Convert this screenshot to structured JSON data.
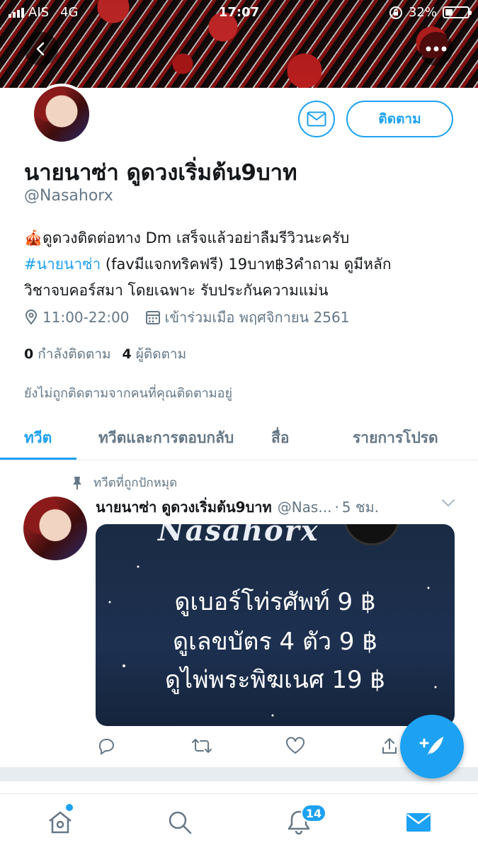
{
  "status_bar": {
    "carrier": "AIS",
    "network": "4G",
    "time": "17:07",
    "battery_percent": "32%",
    "battery_level": 0.32
  },
  "profile": {
    "name": "นายนาซ่า ดูดวงเริ่มต้น9บาท",
    "handle": "@Nasahorx",
    "bio_emoji": "🎪",
    "bio_line1": "ดูดวงติดต่อทาง Dm เสร็จแล้วอย่าลืมรีวิวนะครับ",
    "bio_hashtag": "#นายนาซ่า",
    "bio_line2_rest": " (favมีแจกทริคฟรี) 19บาท฿3คำถาม ดูมีหลัก",
    "bio_line3": "วิชาจบคอร์สมา โดยเฉพาะ รับประกันความแม่น",
    "location": "11:00-22:00",
    "joined": "เข้าร่วมเมือ พฤศจิกายน 2561",
    "following_count": "0",
    "following_label": "กำลังติดตาม",
    "followers_count": "4",
    "followers_label": "ผู้ติดตาม",
    "not_followed_text": "ยังไม่ถูกติดตามจากคนที่คุณติดตามอยู่",
    "follow_button": "ติดตาม"
  },
  "tabs": [
    {
      "label": "ทวีต",
      "active": true
    },
    {
      "label": "ทวีตและการตอบกลับ",
      "active": false
    },
    {
      "label": "สื่อ",
      "active": false
    },
    {
      "label": "รายการโปรด",
      "active": false
    }
  ],
  "tweet": {
    "pinned_label": "ทวีตที่ถูกปักหมุด",
    "author_name": "นายนาซ่า ดูดวงเริ่มต้น9บาท",
    "author_handle": "@Nas...",
    "separator": "·",
    "time": "5 ชม.",
    "media": {
      "brand": "Nasahorx",
      "line1": "ดูเบอร์โท่รศัพท์ 9 ฿",
      "line2": "ดูเลขบัตร 4 ตัว 9 ฿",
      "line3": "ดูไพ่พระพิฆเนศ 19 ฿"
    }
  },
  "bottom_nav": {
    "notifications_badge": "14"
  },
  "colors": {
    "accent": "#1da1f2",
    "secondary_text": "#657786"
  }
}
